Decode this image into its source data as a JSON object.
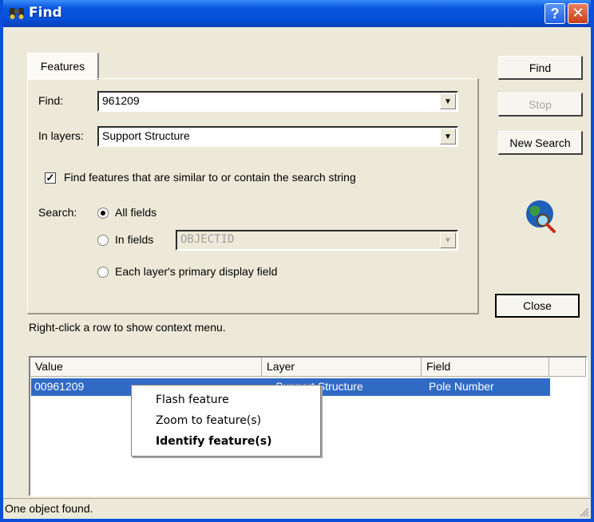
{
  "window": {
    "title": "Find",
    "title_icon": "binoculars-icon",
    "help_label": "?",
    "close_label": "✕",
    "colors": {
      "titlebar": "#0a55e0",
      "face": "#ece9d8",
      "selection": "#316ac5"
    }
  },
  "tab": {
    "label": "Features"
  },
  "form": {
    "find_label": "Find:",
    "find_value": "961209",
    "layers_label": "In layers:",
    "layers_value": "Support Structure",
    "similar_label": "Find features that are similar to or contain the search string",
    "similar_checked": true,
    "search_label": "Search:",
    "options": [
      {
        "label": "All fields",
        "selected": true
      },
      {
        "label": "In fields",
        "selected": false
      },
      {
        "label": "Each layer's primary display field",
        "selected": false
      }
    ],
    "fields_value": "OBJECTID"
  },
  "buttons": {
    "find": "Find",
    "stop": "Stop",
    "new_search": "New Search",
    "close": "Close"
  },
  "hint": "Right-click a row to show context menu.",
  "results": {
    "columns": [
      "Value",
      "Layer",
      "Field"
    ],
    "rows": [
      {
        "value": "00961209",
        "layer": "Support Structure",
        "field": "Pole Number"
      }
    ]
  },
  "context_menu": {
    "items": [
      "Flash feature",
      "Zoom to feature(s)",
      "Identify feature(s)"
    ]
  },
  "status": "One object found."
}
